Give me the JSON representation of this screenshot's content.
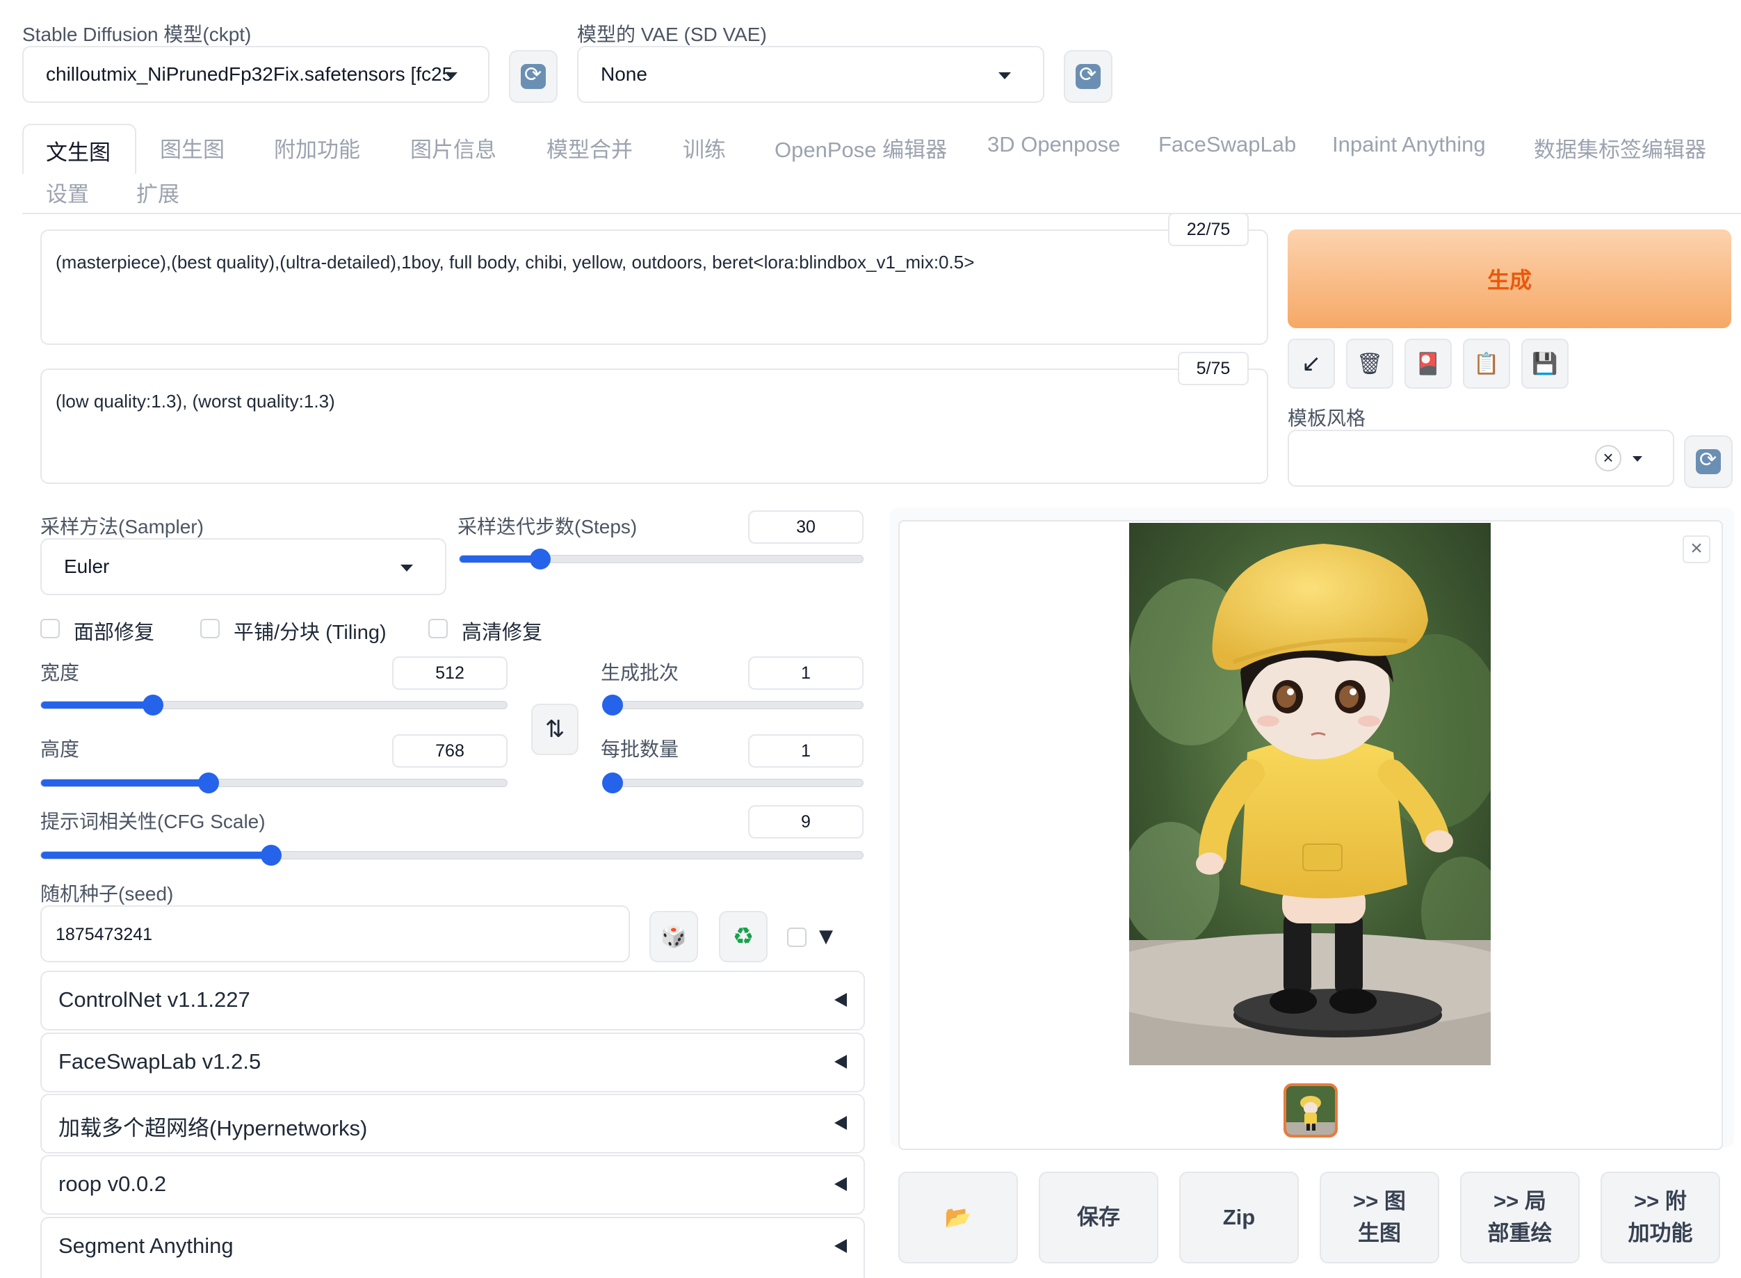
{
  "top": {
    "ckpt_label": "Stable Diffusion 模型(ckpt)",
    "ckpt_value": "chilloutmix_NiPrunedFp32Fix.safetensors [fc25",
    "vae_label": "模型的 VAE (SD VAE)",
    "vae_value": "None"
  },
  "tabs": [
    {
      "label": "文生图",
      "active": true
    },
    {
      "label": "图生图"
    },
    {
      "label": "附加功能"
    },
    {
      "label": "图片信息"
    },
    {
      "label": "模型合并"
    },
    {
      "label": "训练"
    },
    {
      "label": "OpenPose 编辑器"
    },
    {
      "label": "3D Openpose"
    },
    {
      "label": "FaceSwapLab"
    },
    {
      "label": "Inpaint Anything"
    },
    {
      "label": "数据集标签编辑器"
    },
    {
      "label": "设置"
    },
    {
      "label": "扩展"
    }
  ],
  "prompt": {
    "positive": "(masterpiece),(best quality),(ultra-detailed),1boy, full body, chibi, yellow, outdoors, beret<lora:blindbox_v1_mix:0.5>",
    "positive_count": "22/75",
    "negative": "(low quality:1.3), (worst quality:1.3)",
    "negative_count": "5/75"
  },
  "generate": {
    "label": "生成",
    "style_label": "模板风格",
    "clear_glyph": "×"
  },
  "sampler": {
    "label": "采样方法(Sampler)",
    "value": "Euler",
    "steps_label": "采样迭代步数(Steps)",
    "steps_value": "30",
    "steps_fraction": 0.2
  },
  "options": {
    "face_restore": "面部修复",
    "tiling": "平铺/分块 (Tiling)",
    "hires": "高清修复"
  },
  "size": {
    "width_label": "宽度",
    "width_value": "512",
    "width_fraction": 0.24,
    "height_label": "高度",
    "height_value": "768",
    "height_fraction": 0.36,
    "swap_glyph": "⇅"
  },
  "batch": {
    "count_label": "生成批次",
    "count_value": "1",
    "count_fraction": 0.0,
    "size_label": "每批数量",
    "size_value": "1",
    "size_fraction": 0.0
  },
  "cfg": {
    "label": "提示词相关性(CFG Scale)",
    "value": "9",
    "fraction": 0.28
  },
  "seed": {
    "label": "随机种子(seed)",
    "value": "1875473241",
    "dice_glyph": "🎲",
    "recycle_glyph": "♻",
    "extra_glyph": "▼"
  },
  "accordions": [
    "ControlNet v1.1.227",
    "FaceSwapLab v1.2.5",
    "加载多个超网络(Hypernetworks)",
    "roop v0.0.2",
    "Segment Anything"
  ],
  "output": {
    "close_glyph": "×",
    "folder_glyph": "📂",
    "save": "保存",
    "zip": "Zip",
    "to_img2img_1": ">> 图",
    "to_img2img_2": "生图",
    "to_inpaint_1": ">> 局",
    "to_inpaint_2": "部重绘",
    "to_extras_1": ">> 附",
    "to_extras_2": "加功能"
  },
  "tool_icons": {
    "arrow": "↙",
    "trash": "🗑",
    "card": "🎴",
    "clipboard": "📋",
    "save": "💾"
  },
  "colors": {
    "accent_blue": "#2563eb",
    "generate_orange": "#f5a76a",
    "generate_text": "#ea580c",
    "active_thumb_border": "#ea7b3c"
  }
}
